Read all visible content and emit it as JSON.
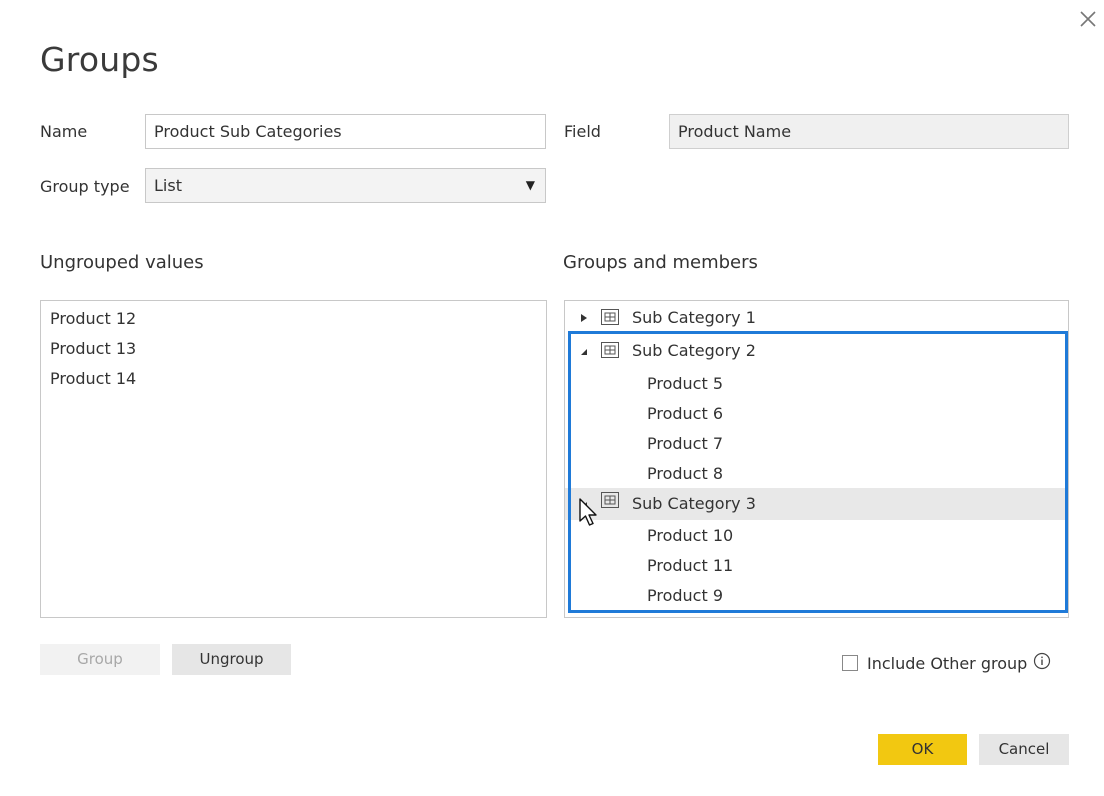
{
  "dialog": {
    "title": "Groups",
    "close_icon": "close-icon"
  },
  "form": {
    "name_label": "Name",
    "name_value": "Product Sub Categories",
    "field_label": "Field",
    "field_value": "Product Name",
    "group_type_label": "Group type",
    "group_type_value": "List"
  },
  "ungrouped": {
    "heading": "Ungrouped values",
    "items": [
      "Product 12",
      "Product 13",
      "Product 14"
    ]
  },
  "groups": {
    "heading": "Groups and members",
    "tree": [
      {
        "label": "Sub Category 1",
        "expanded": false,
        "members": []
      },
      {
        "label": "Sub Category 2",
        "expanded": true,
        "members": [
          "Product 5",
          "Product 6",
          "Product 7",
          "Product 8"
        ]
      },
      {
        "label": "Sub Category 3",
        "expanded": true,
        "members": [
          "Product 10",
          "Product 11",
          "Product 9"
        ]
      }
    ]
  },
  "buttons": {
    "group": "Group",
    "ungroup": "Ungroup",
    "ok": "OK",
    "cancel": "Cancel"
  },
  "options": {
    "include_other_label": "Include Other group",
    "include_other_checked": false
  },
  "colors": {
    "accent": "#f2c811",
    "selection_border": "#1f7ad8",
    "hover_row": "#e8e8e8"
  }
}
